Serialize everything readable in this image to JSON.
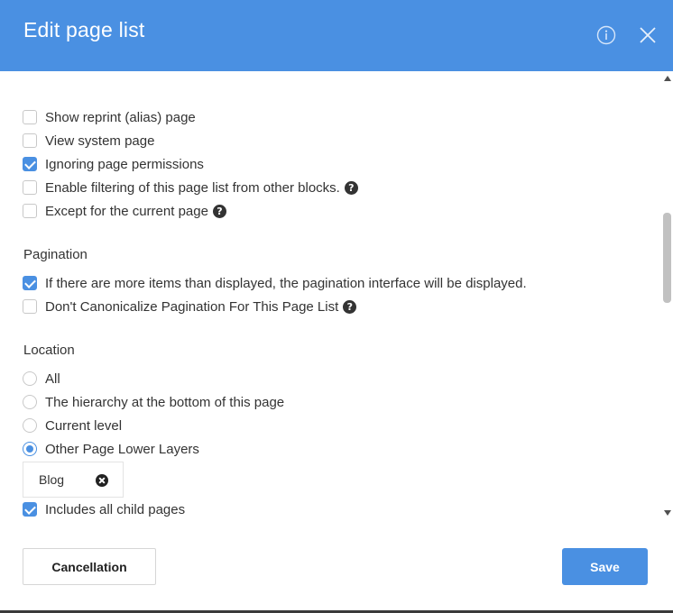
{
  "dialog": {
    "title": "Edit page list",
    "icons": {
      "info": "info-circle-icon",
      "close": "close-icon"
    }
  },
  "options": [
    {
      "label": "Show reprint (alias) page",
      "checked": false,
      "help": false
    },
    {
      "label": "View system page",
      "checked": false,
      "help": false
    },
    {
      "label": "Ignoring page permissions",
      "checked": true,
      "help": false
    },
    {
      "label": "Enable filtering of this page list from other blocks.",
      "checked": false,
      "help": true
    },
    {
      "label": "Except for the current page",
      "checked": false,
      "help": true
    }
  ],
  "pagination": {
    "heading": "Pagination",
    "options": [
      {
        "label": "If there are more items than displayed, the pagination interface will be displayed.",
        "checked": true,
        "help": false
      },
      {
        "label": "Don't Canonicalize Pagination For This Page List",
        "checked": false,
        "help": true
      }
    ]
  },
  "location": {
    "heading": "Location",
    "radios": [
      {
        "label": "All",
        "selected": false
      },
      {
        "label": "The hierarchy at the bottom of this page",
        "selected": false
      },
      {
        "label": "Current level",
        "selected": false
      },
      {
        "label": "Other Page Lower Layers",
        "selected": true
      }
    ],
    "selected_page": "Blog",
    "include_children": {
      "label": "Includes all child pages",
      "checked": true
    }
  },
  "footer": {
    "cancel_label": "Cancellation",
    "save_label": "Save"
  },
  "colors": {
    "accent": "#4a90e2"
  }
}
